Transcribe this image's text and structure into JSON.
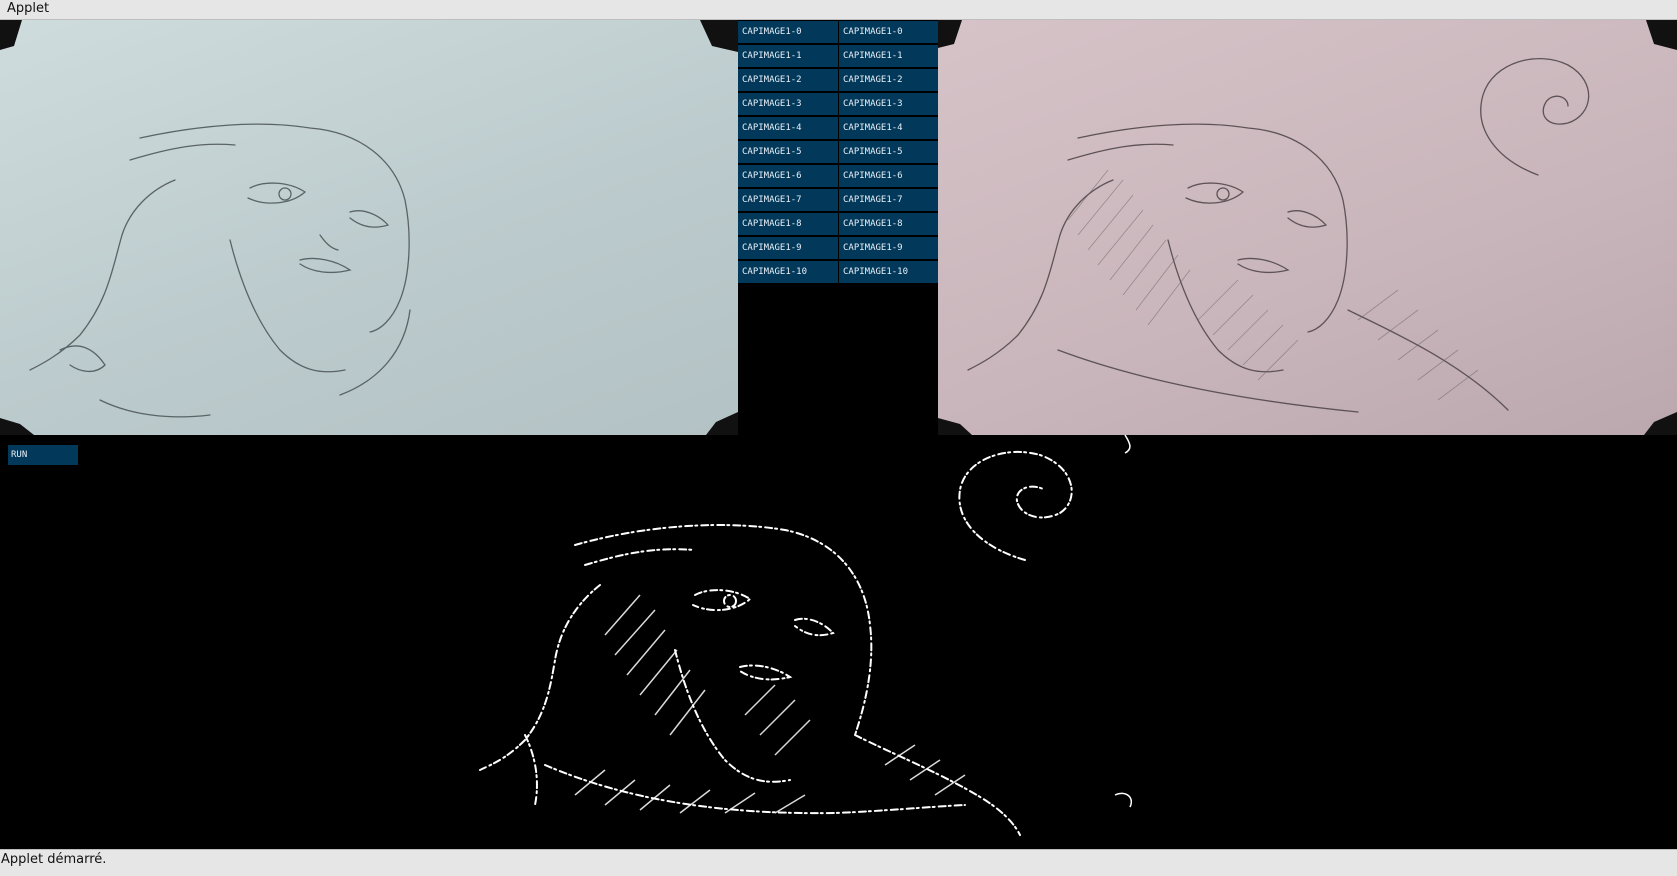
{
  "window": {
    "title": "Applet"
  },
  "capture_buttons": {
    "left": [
      "CAPIMAGE1-0",
      "CAPIMAGE1-1",
      "CAPIMAGE1-2",
      "CAPIMAGE1-3",
      "CAPIMAGE1-4",
      "CAPIMAGE1-5",
      "CAPIMAGE1-6",
      "CAPIMAGE1-7",
      "CAPIMAGE1-8",
      "CAPIMAGE1-9",
      "CAPIMAGE1-10"
    ],
    "right": [
      "CAPIMAGE1-0",
      "CAPIMAGE1-1",
      "CAPIMAGE1-2",
      "CAPIMAGE1-3",
      "CAPIMAGE1-4",
      "CAPIMAGE1-5",
      "CAPIMAGE1-6",
      "CAPIMAGE1-7",
      "CAPIMAGE1-8",
      "CAPIMAGE1-9",
      "CAPIMAGE1-10"
    ]
  },
  "run_button": {
    "label": "RUN"
  },
  "status": {
    "text": "Applet démarré."
  },
  "colors": {
    "button_bg": "#02385a",
    "button_text": "#e8f0f6",
    "background": "#000000",
    "chrome": "#e6e6e6"
  }
}
